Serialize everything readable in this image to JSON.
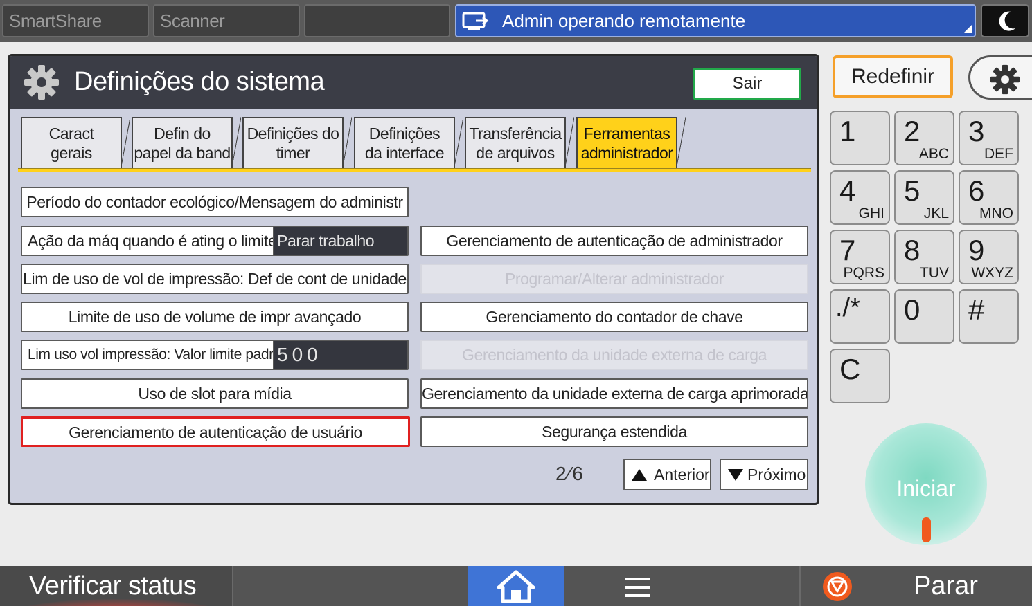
{
  "topbar": {
    "tabs": [
      "SmartShare",
      "Scanner",
      ""
    ],
    "remote_status": "Admin operando remotamente"
  },
  "panel": {
    "title": "Definições do sistema",
    "exit_label": "Sair",
    "tabs": [
      {
        "line1": "Caract",
        "line2": "gerais"
      },
      {
        "line1": "Defin do",
        "line2": "papel da band"
      },
      {
        "line1": "Definições do",
        "line2": "timer"
      },
      {
        "line1": "Definições",
        "line2": "da interface"
      },
      {
        "line1": "Transferência",
        "line2": "de arquivos"
      },
      {
        "line1": "Ferramentas",
        "line2": "administrador"
      }
    ],
    "active_tab": 5,
    "left_column": {
      "eco_counter": "Período do contador ecológico/Mensagem do administr",
      "limit_action_label": "Ação da máq quando é ating o limite",
      "limit_action_value": "Parar trabalho",
      "print_volume_unit": "Lim de uso de vol de impressão: Def de cont de unidade",
      "advanced_volume": "Limite de uso de volume de impr avançado",
      "default_limit_label": "Lim uso vol impressão: Valor limite padrão",
      "default_limit_value": "500",
      "media_slot": "Uso de slot para mídia",
      "user_auth": "Gerenciamento de autenticação de usuário"
    },
    "right_column": {
      "admin_auth": "Gerenciamento de autenticação de administrador",
      "program_admin": "Programar/Alterar administrador",
      "key_counter": "Gerenciamento do contador de chave",
      "external_charge": "Gerenciamento da unidade externa de carga",
      "enhanced_external_charge": "Gerenciamento da unidade externa de carga aprimorada",
      "extended_security": "Segurança estendida"
    },
    "pager": {
      "page": "2⁄6",
      "prev_label": "Anterior",
      "next_label": "Próximo"
    }
  },
  "side": {
    "reset_label": "Redefinir",
    "keypad": [
      {
        "digit": "1",
        "letters": ""
      },
      {
        "digit": "2",
        "letters": "ABC"
      },
      {
        "digit": "3",
        "letters": "DEF"
      },
      {
        "digit": "4",
        "letters": "GHI"
      },
      {
        "digit": "5",
        "letters": "JKL"
      },
      {
        "digit": "6",
        "letters": "MNO"
      },
      {
        "digit": "7",
        "letters": "PQRS"
      },
      {
        "digit": "8",
        "letters": "TUV"
      },
      {
        "digit": "9",
        "letters": "WXYZ"
      },
      {
        "digit": "./*",
        "letters": ""
      },
      {
        "digit": "0",
        "letters": ""
      },
      {
        "digit": "#",
        "letters": ""
      },
      {
        "digit": "C",
        "letters": ""
      }
    ],
    "start_label": "Iniciar"
  },
  "bottombar": {
    "status_label": "Verificar status",
    "stop_label": "Parar"
  },
  "colors": {
    "accent_yellow": "#ffd11a",
    "remote_banner": "#2d57b7",
    "reset_border": "#f5a02a",
    "highlight_red": "#e02020",
    "home_blue": "#3f74d6",
    "start_green": "#7fd9c2",
    "stop_orange": "#f05a1e"
  }
}
